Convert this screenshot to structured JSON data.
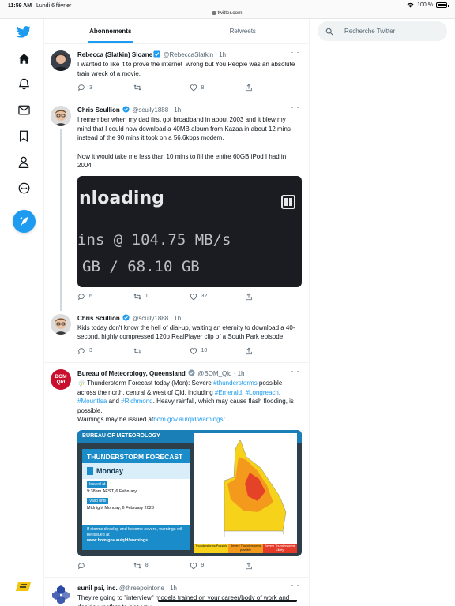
{
  "status": {
    "time": "11:59 AM",
    "date": "Lundi 6 février",
    "url": "twitter.com",
    "battery": "100 %",
    "battery_level": 1.0
  },
  "nav": {
    "items": [
      "twitter-logo-icon",
      "home-icon",
      "notifications-bell-icon",
      "messages-envelope-icon",
      "bookmark-icon",
      "profile-icon",
      "more-circle-icon",
      "compose-tweet-icon",
      "user-avatar"
    ]
  },
  "tabs": [
    {
      "label": "Abonnements",
      "active": true
    },
    {
      "label": "Retweets",
      "active": false
    }
  ],
  "search": {
    "placeholder": "Recherche Twitter"
  },
  "tweets": [
    {
      "name": "Rebecca (Slatkin) Sloane",
      "handle": "@RebeccaSlatkin · 1h",
      "text": "I wanted to like it to prove the internet  wrong but You People was an absolute train wreck of a movie.",
      "replies": "3",
      "retweets": "",
      "likes": "8"
    },
    {
      "name": "Chris Scullion",
      "handle": "@scully1888 · 1h",
      "text": "I remember when my dad first got broadband in about 2003 and it blew my mind that I could now download a 40MB album from Kazaa in about 12 mins instead of the 90 mins it took on a 56.6kbps modem.\n\nNow it would take me less than 10 mins to fill the entire 60GB iPod I had in 2004",
      "media": {
        "line1": "nloading",
        "line2": "ins @ 104.75 MB/s",
        "line3": "GB / 68.10 GB"
      },
      "replies": "6",
      "retweets": "1",
      "likes": "32"
    },
    {
      "name": "Chris Scullion",
      "handle": "@scully1888 · 1h",
      "text": "Kids today don't know the hell of dial-up, waiting an eternity to download a 40-second, highly compressed 120p RealPlayer clip of a South Park episode",
      "replies": "3",
      "retweets": "",
      "likes": "10"
    },
    {
      "name": "Bureau of Meteorology, Queensland",
      "handle": "@BOM_Qld · 1h",
      "avatar_text": [
        "BOM",
        "Qld"
      ],
      "text_parts": [
        "⛈️ Thunderstorm Forecast today (Mon): Severe ",
        "#thunderstorms",
        " possible across the north, central & west of Qld, including ",
        "#Emerald",
        ", ",
        "#Longreach",
        ", ",
        "#MountIsa",
        " and ",
        "#Richmond",
        ". Heavy rainfall, which may cause flash flooding, is possible.\nWarnings may be issued at",
        "bom.gov.au/qld/warnings/"
      ],
      "card": {
        "header": "BUREAU OF METEOROLOGY",
        "title": "THUNDERSTORM FORECAST",
        "day": "Monday",
        "issued_label": "Issued at",
        "issued": "9:38am AEST, 6 February",
        "valid_label": "Valid until",
        "valid": "Midnight Monday, 6 February 2023",
        "footer_1": "If storms develop and become severe, warnings will be issued at",
        "footer_2": "www.bom.gov.au/qld/warnings",
        "legend": [
          "Thunderstorms Possible",
          "Severe Thunderstorms possible",
          "Severe Thunderstorms Likely"
        ],
        "legend_colors": [
          "#f6d21a",
          "#f39a1c",
          "#e33a2a"
        ]
      },
      "replies": "",
      "retweets": "8",
      "likes": "9"
    },
    {
      "name": "sunil pai, inc.",
      "handle": "@threepointone · 1h",
      "text": "They're going to \"interview\" models trained on your career/body of work and decide whether to hire you"
    }
  ],
  "colors": {
    "accent": "#1d9bf0",
    "text": "#0f1419",
    "muted": "#536471",
    "bom_red": "#c8102e"
  }
}
